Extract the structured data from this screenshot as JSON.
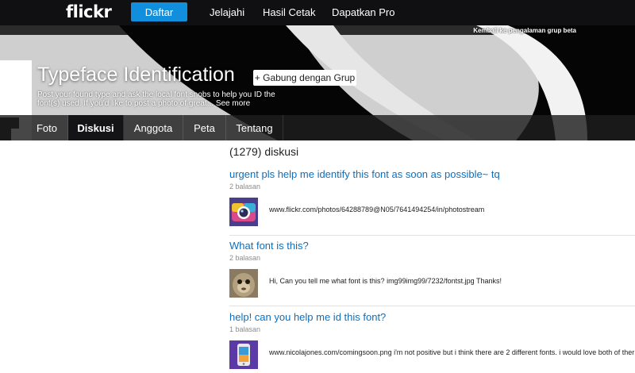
{
  "nav": {
    "logo": "flickr",
    "signup": "Daftar",
    "explore": "Jelajahi",
    "prints": "Hasil Cetak",
    "pro": "Dapatkan Pro"
  },
  "hero": {
    "back_link": "Kembali ke pengalaman grup beta",
    "title": "Typeface Identification",
    "join": "+ Gabung dengan Grup",
    "description": "Post your found type and ask the local font snobs to help you ID the font(s) used. If you'd like to post a photo of great...",
    "see_more": "See more"
  },
  "tabs": [
    {
      "label": "Foto"
    },
    {
      "label": "Diskusi"
    },
    {
      "label": "Anggota"
    },
    {
      "label": "Peta"
    },
    {
      "label": "Tentang"
    }
  ],
  "discussions": {
    "count": "(1279) diskusi",
    "topics": [
      {
        "title": "urgent pls help me identify this font as soon as possible~ tq",
        "replies": "2 balasan",
        "snippet": "www.flickr.com/photos/64288789@N05/7641494254/in/photostream",
        "thumb_icon": "camera-app-icon"
      },
      {
        "title": "What font is this?",
        "replies": "2 balasan",
        "snippet": "Hi, Can you tell me what font is this? img99img99/7232/fontst.jpg Thanks!",
        "thumb_icon": "monkey-avatar"
      },
      {
        "title": "help! can you help me id this font?",
        "replies": "1 balasan",
        "snippet": "www.nicolajones.com/comingsoon.png i'm not positive but i think there are 2 different fonts. i would love both of ther",
        "thumb_icon": "phone-app-icon"
      }
    ]
  },
  "colors": {
    "nav_bg": "#101012",
    "signup_bg": "#128fdc",
    "link": "#0c6fbf",
    "tab_active": "#141416"
  }
}
